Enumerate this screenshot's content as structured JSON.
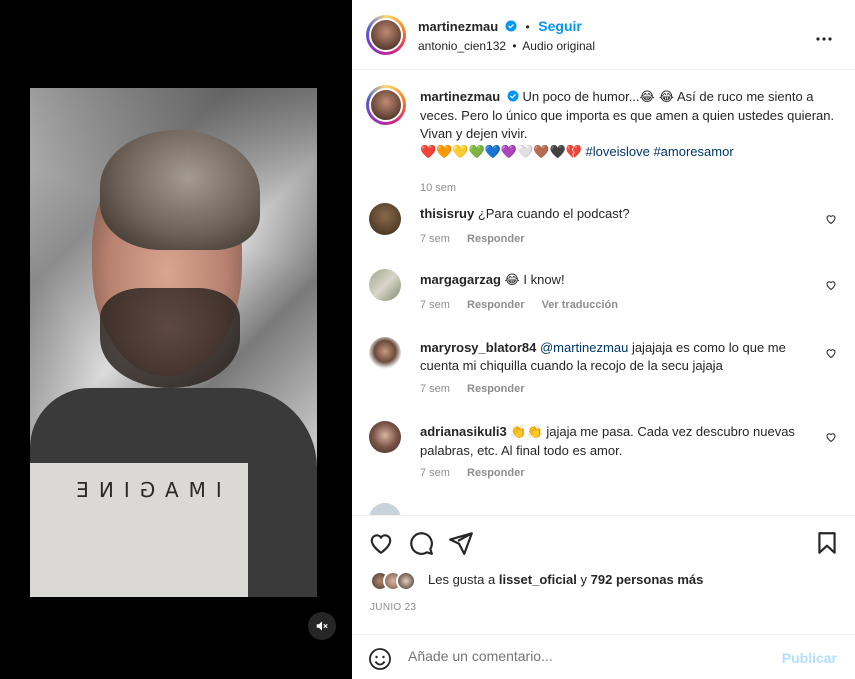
{
  "post": {
    "username": "martinezmau",
    "follow_label": "Seguir",
    "dot": "•",
    "audio_user": "antonio_cien132",
    "audio_sep": "•",
    "audio_label": "Audio original",
    "video_shirt_text": "IMAGINE",
    "caption": {
      "text_start": "Un poco de humor...",
      "laugh_emojis": "😂 😂",
      "text_rest": "Así de ruco me siento a veces. Pero lo único que importa es que amen a quien ustedes quieran. Vivan y dejen vivir.",
      "hearts": "❤️🧡💛💚💙💜🤍🤎🖤💔",
      "hashtag1": "#loveislove",
      "hashtag2": "#amoresamor",
      "age": "10 sem"
    }
  },
  "comments": [
    {
      "user": "thisisruy",
      "text": "¿Para cuando el podcast?",
      "age": "7 sem",
      "reply": "Responder",
      "translate": ""
    },
    {
      "user": "margagarzag",
      "emoji": "😂",
      "text": "I know!",
      "age": "7 sem",
      "reply": "Responder",
      "translate": "Ver traducción"
    },
    {
      "user": "maryrosy_blator84",
      "mention": "@martinezmau",
      "text": "jajajaja es como lo que me cuenta mi chiquilla cuando la recojo de la secu jajaja",
      "age": "7 sem",
      "reply": "Responder",
      "translate": ""
    },
    {
      "user": "adrianasikuli3",
      "emoji": "👏👏",
      "text": "jajaja me pasa. Cada vez descubro nuevas palabras, etc. Al final todo es amor.",
      "age": "7 sem",
      "reply": "Responder",
      "translate": ""
    }
  ],
  "likes": {
    "prefix": "Les gusta a",
    "user": "lisset_oficial",
    "mid": "y",
    "count": "792 personas más"
  },
  "date": "JUNIO 23",
  "composer": {
    "placeholder": "Añade un comentario...",
    "publish": "Publicar"
  },
  "colors": {
    "accent": "#0095f6",
    "link": "#00376b",
    "muted": "#8e8e8e",
    "publish_disabled": "#b2dffc"
  },
  "icons": [
    "more-icon",
    "verified-icon",
    "heart-icon",
    "comment-icon",
    "share-icon",
    "bookmark-icon",
    "emoji-icon",
    "mute-icon"
  ]
}
